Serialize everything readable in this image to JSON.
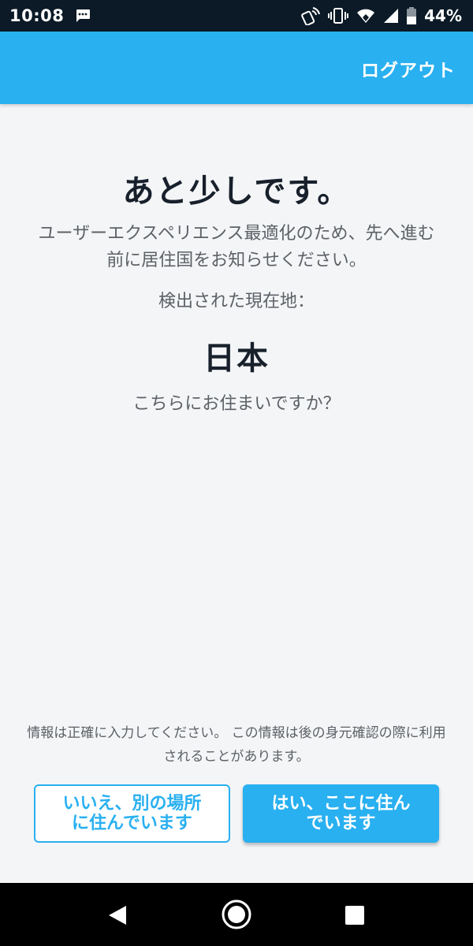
{
  "status_bar": {
    "time": "10:08",
    "battery_percent": "44%",
    "icons": [
      "message-icon",
      "nfc-icon",
      "vibrate-icon",
      "wifi-icon",
      "signal-icon",
      "battery-icon"
    ]
  },
  "app_bar": {
    "logout_label": "ログアウト",
    "color": "#29b0f0"
  },
  "main": {
    "title": "あと少しです。",
    "description": "ユーザーエクスペリエンス最適化のため、先へ進む前に居住国をお知らせください。",
    "detected_label": "検出された現在地：",
    "country": "日本",
    "question": "こちらにお住まいですか？",
    "note": "情報は正確に入力してください。 この情報は後の身元確認の際に利用されることがあります。"
  },
  "buttons": {
    "no_label_line1": "いいえ、別の場所",
    "no_label_line2": "に住んでいます",
    "yes_label_line1": "はい、ここに住ん",
    "yes_label_line2": "でいます"
  },
  "nav_bar": {
    "icons": [
      "back-icon",
      "home-icon",
      "recent-apps-icon"
    ]
  }
}
